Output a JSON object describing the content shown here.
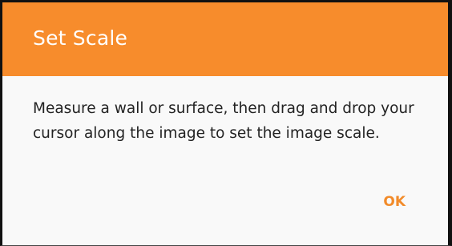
{
  "dialog": {
    "title": "Set Scale",
    "message": "Measure a wall or surface, then drag and drop your cursor along the image to set the image scale.",
    "ok_label": "OK"
  },
  "colors": {
    "header_background": "#f78c2c",
    "accent": "#f28b2a",
    "body_background": "#f9f9f9",
    "text": "#232323"
  }
}
